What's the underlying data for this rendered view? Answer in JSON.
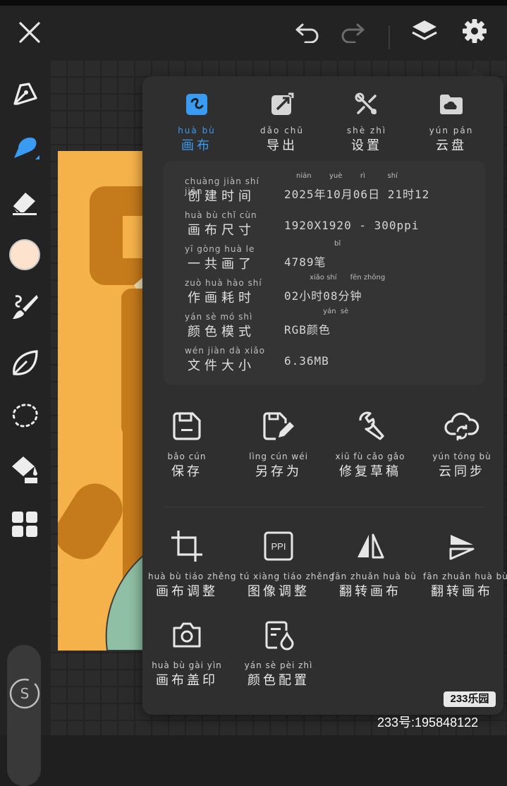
{
  "colors": {
    "accent": "#3a9bf3",
    "panel": "#2f2f2f",
    "canvas_bg": "#f6b24a",
    "brush_color": "#fde3cd"
  },
  "topbar": {
    "icons": [
      "close-icon",
      "undo-icon",
      "redo-icon",
      "layers-icon",
      "settings-icon"
    ]
  },
  "sidebar": {
    "tools": [
      "pen-icon",
      "smudge-icon",
      "eraser-icon",
      "color-swatch",
      "brush-icon",
      "leaf-icon",
      "lasso-icon",
      "fill-bucket-icon",
      "grid-icon"
    ],
    "slider_icon": "s-size-icon"
  },
  "panel": {
    "tabs": [
      {
        "pinyin": "huà  bù",
        "label": "画布",
        "icon": "canvas-icon",
        "active": true
      },
      {
        "pinyin": "dǎo  chū",
        "label": "导出",
        "icon": "export-icon",
        "active": false
      },
      {
        "pinyin": "shè  zhì",
        "label": "设置",
        "icon": "settings-tools-icon",
        "active": false
      },
      {
        "pinyin": "yún  pán",
        "label": "云盘",
        "icon": "cloud-folder-icon",
        "active": false
      }
    ],
    "info": [
      {
        "pinyin": "chuàng jiàn  shí  jiān",
        "label": "创建时间",
        "value": "2025年10月06日 21时12",
        "value_pinyin": "nián        yuè        rì          shí"
      },
      {
        "pinyin": "huà  bù  chǐ  cùn",
        "label": "画布尺寸",
        "value": "1920X1920 - 300ppi",
        "value_pinyin": ""
      },
      {
        "pinyin": "yī  gòng huà  le",
        "label": "一共画了",
        "value": "4789笔",
        "value_pinyin": "                 bǐ"
      },
      {
        "pinyin": "zuò  huà  hào  shí",
        "label": "作画耗时",
        "value": "02小时08分钟",
        "value_pinyin": "      xiǎo shí      fēn zhōng"
      },
      {
        "pinyin": "yán  sè  mó  shì",
        "label": "颜色模式",
        "value": "RGB颜色",
        "value_pinyin": "            yán  sè"
      },
      {
        "pinyin": "wén  jiàn  dà  xiǎo",
        "label": "文件大小",
        "value": "6.36MB",
        "value_pinyin": ""
      }
    ],
    "actions_row1": [
      {
        "pinyin": "bǎo  cún",
        "label": "保存",
        "icon": "save-icon"
      },
      {
        "pinyin": "lìng  cún  wéi",
        "label": "另存为",
        "icon": "save-as-icon"
      },
      {
        "pinyin": "xiū  fù  cǎo  gǎo",
        "label": "修复草稿",
        "icon": "repair-icon"
      },
      {
        "pinyin": "yún tóng  bù",
        "label": "云同步",
        "icon": "cloud-sync-icon"
      }
    ],
    "actions_row2": [
      {
        "pinyin": "huà  bù  tiáo zhěng",
        "label": "画布调整",
        "icon": "crop-icon"
      },
      {
        "pinyin": "tú  xiàng tiáo zhěng",
        "label": "图像调整",
        "icon": "ppi-icon",
        "icon_text": "PPI"
      },
      {
        "pinyin": "fān zhuǎn huà  bù",
        "label": "翻转画布",
        "icon": "flip-horizontal-icon"
      },
      {
        "pinyin": "fān zhuǎn huà  bù",
        "label": "翻转画布",
        "icon": "flip-vertical-icon"
      }
    ],
    "actions_row3": [
      {
        "pinyin": "huà  bù  gài  yìn",
        "label": "画布盖印",
        "icon": "camera-icon"
      },
      {
        "pinyin": "yán  sè  pèi  zhì",
        "label": "颜色配置",
        "icon": "color-config-icon"
      }
    ]
  },
  "watermark": {
    "badge": "233乐园",
    "text": "233号:195848122"
  }
}
